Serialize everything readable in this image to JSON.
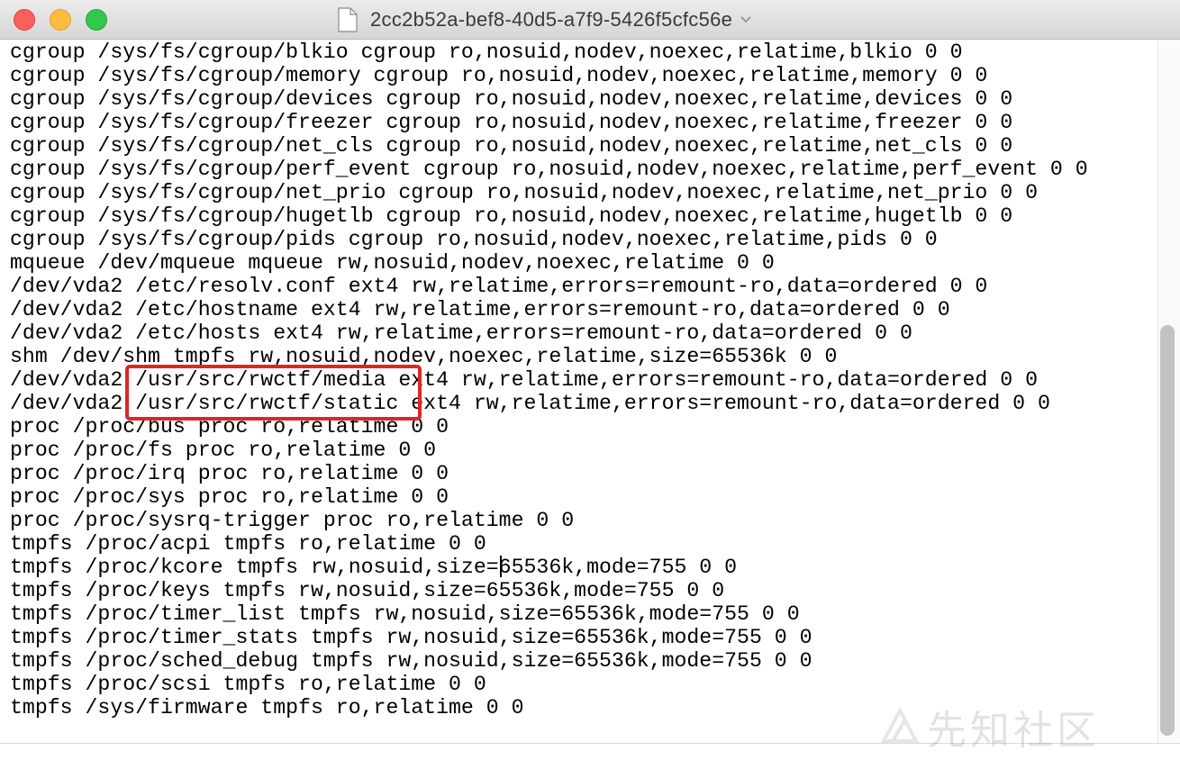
{
  "window": {
    "title": "2cc2b52a-bef8-40d5-a7f9-5426f5cfc56e"
  },
  "editor": {
    "lines": [
      "cgroup /sys/fs/cgroup/blkio cgroup ro,nosuid,nodev,noexec,relatime,blkio 0 0",
      "cgroup /sys/fs/cgroup/memory cgroup ro,nosuid,nodev,noexec,relatime,memory 0 0",
      "cgroup /sys/fs/cgroup/devices cgroup ro,nosuid,nodev,noexec,relatime,devices 0 0",
      "cgroup /sys/fs/cgroup/freezer cgroup ro,nosuid,nodev,noexec,relatime,freezer 0 0",
      "cgroup /sys/fs/cgroup/net_cls cgroup ro,nosuid,nodev,noexec,relatime,net_cls 0 0",
      "cgroup /sys/fs/cgroup/perf_event cgroup ro,nosuid,nodev,noexec,relatime,perf_event 0 0",
      "cgroup /sys/fs/cgroup/net_prio cgroup ro,nosuid,nodev,noexec,relatime,net_prio 0 0",
      "cgroup /sys/fs/cgroup/hugetlb cgroup ro,nosuid,nodev,noexec,relatime,hugetlb 0 0",
      "cgroup /sys/fs/cgroup/pids cgroup ro,nosuid,nodev,noexec,relatime,pids 0 0",
      "mqueue /dev/mqueue mqueue rw,nosuid,nodev,noexec,relatime 0 0",
      "/dev/vda2 /etc/resolv.conf ext4 rw,relatime,errors=remount-ro,data=ordered 0 0",
      "/dev/vda2 /etc/hostname ext4 rw,relatime,errors=remount-ro,data=ordered 0 0",
      "/dev/vda2 /etc/hosts ext4 rw,relatime,errors=remount-ro,data=ordered 0 0",
      "shm /dev/shm tmpfs rw,nosuid,nodev,noexec,relatime,size=65536k 0 0",
      "/dev/vda2 /usr/src/rwctf/media ext4 rw,relatime,errors=remount-ro,data=ordered 0 0",
      "/dev/vda2 /usr/src/rwctf/static ext4 rw,relatime,errors=remount-ro,data=ordered 0 0",
      "proc /proc/bus proc ro,relatime 0 0",
      "proc /proc/fs proc ro,relatime 0 0",
      "proc /proc/irq proc ro,relatime 0 0",
      "proc /proc/sys proc ro,relatime 0 0",
      "proc /proc/sysrq-trigger proc ro,relatime 0 0",
      "tmpfs /proc/acpi tmpfs ro,relatime 0 0",
      "tmpfs /proc/kcore tmpfs rw,nosuid,size=65536k,mode=755 0 0",
      "tmpfs /proc/keys tmpfs rw,nosuid,size=65536k,mode=755 0 0",
      "tmpfs /proc/timer_list tmpfs rw,nosuid,size=65536k,mode=755 0 0",
      "tmpfs /proc/timer_stats tmpfs rw,nosuid,size=65536k,mode=755 0 0",
      "tmpfs /proc/sched_debug tmpfs rw,nosuid,size=65536k,mode=755 0 0",
      "tmpfs /proc/scsi tmpfs ro,relatime 0 0",
      "tmpfs /sys/firmware tmpfs ro,relatime 0 0"
    ]
  },
  "watermark": {
    "text": "先知社区"
  },
  "colors": {
    "highlight": "#e0242a",
    "close": "#fc605c",
    "minimize": "#fdbc40",
    "zoom": "#34c84a"
  }
}
